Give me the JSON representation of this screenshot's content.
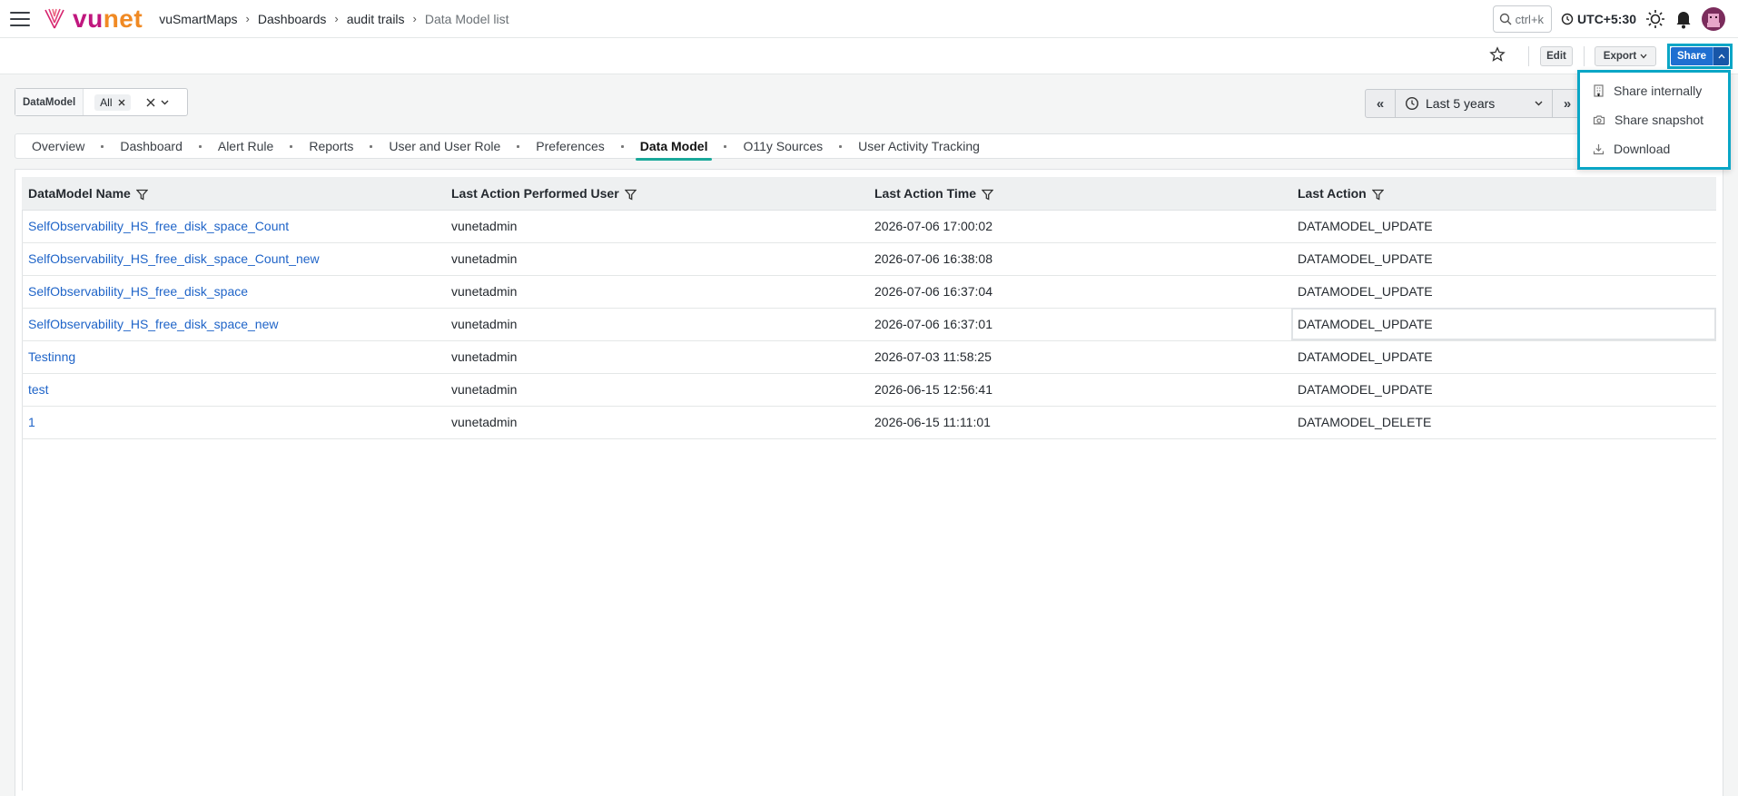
{
  "brand": {
    "name_part1": "vu",
    "name_part2": "net"
  },
  "breadcrumb": {
    "items": [
      "vuSmartMaps",
      "Dashboards",
      "audit trails"
    ],
    "current": "Data Model list"
  },
  "topbar": {
    "search_placeholder": "ctrl+k",
    "timezone": "UTC+5:30"
  },
  "toolbar": {
    "edit_label": "Edit",
    "export_label": "Export",
    "share_label": "Share"
  },
  "share_menu": {
    "items": [
      "Share internally",
      "Share snapshot",
      "Download"
    ]
  },
  "filter": {
    "label": "DataModel",
    "chip": "All"
  },
  "timepicker": {
    "range": "Last 5 years"
  },
  "tabs": {
    "items": [
      "Overview",
      "Dashboard",
      "Alert Rule",
      "Reports",
      "User and User Role",
      "Preferences",
      "Data Model",
      "O11y Sources",
      "User Activity Tracking"
    ],
    "active": "Data Model"
  },
  "table": {
    "columns": [
      "DataModel Name",
      "Last Action Performed User",
      "Last Action Time",
      "Last Action"
    ],
    "rows": [
      [
        "SelfObservability_HS_free_disk_space_Count",
        "vunetadmin",
        "2026-07-06 17:00:02",
        "DATAMODEL_UPDATE"
      ],
      [
        "SelfObservability_HS_free_disk_space_Count_new",
        "vunetadmin",
        "2026-07-06 16:38:08",
        "DATAMODEL_UPDATE"
      ],
      [
        "SelfObservability_HS_free_disk_space",
        "vunetadmin",
        "2026-07-06 16:37:04",
        "DATAMODEL_UPDATE"
      ],
      [
        "SelfObservability_HS_free_disk_space_new",
        "vunetadmin",
        "2026-07-06 16:37:01",
        "DATAMODEL_UPDATE"
      ],
      [
        "Testinng",
        "vunetadmin",
        "2026-07-03 11:58:25",
        "DATAMODEL_UPDATE"
      ],
      [
        "test",
        "vunetadmin",
        "2026-06-15 12:56:41",
        "DATAMODEL_UPDATE"
      ],
      [
        "1",
        "vunetadmin",
        "2026-06-15 11:11:01",
        "DATAMODEL_DELETE"
      ]
    ]
  },
  "colors": {
    "accent": "#1f6fd1",
    "highlight": "#0aa6c6",
    "tab_active": "#1aa89a",
    "link": "#1f64c8"
  }
}
